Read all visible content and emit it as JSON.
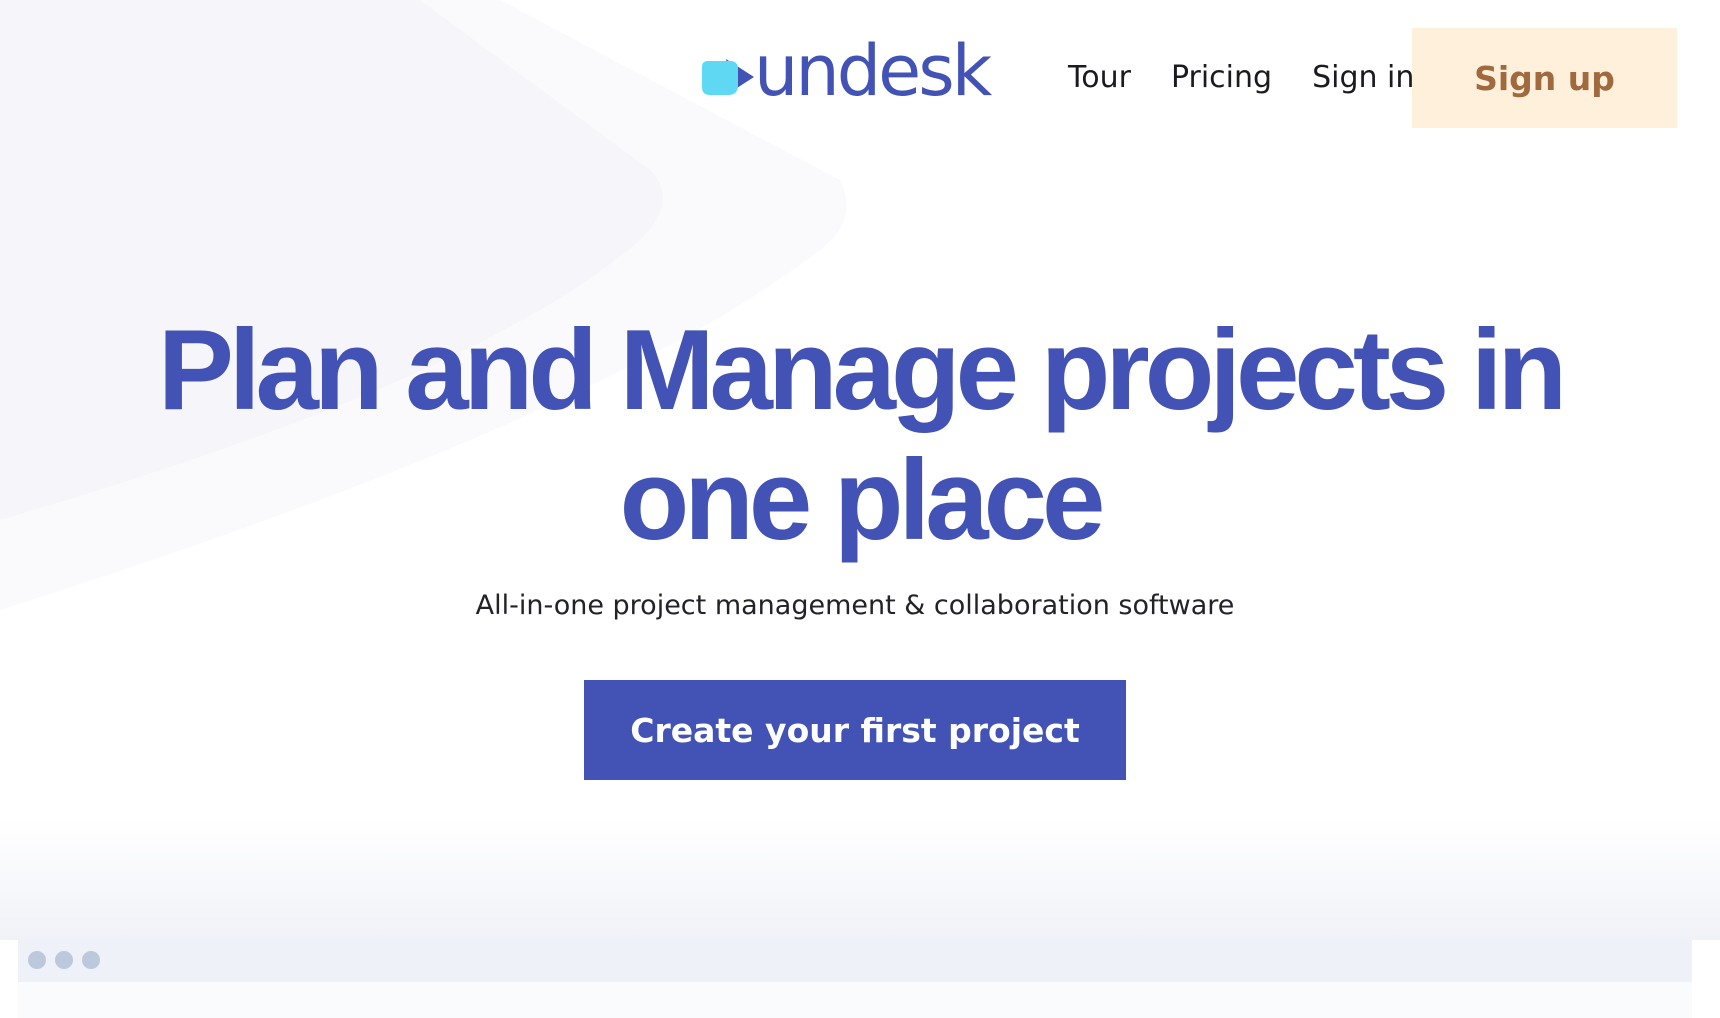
{
  "brand": {
    "name": "undesk",
    "color": "#4253b5",
    "accent": "#5fd8f4"
  },
  "nav": {
    "links": [
      "Tour",
      "Pricing",
      "Sign in"
    ],
    "signup_label": "Sign up",
    "signup_bg": "#fff0dc",
    "signup_fg": "#a06a3e"
  },
  "hero": {
    "title": "Plan and Manage projects in one place",
    "subtitle": "All-in-one project management & collaboration software",
    "cta_label": "Create your first project"
  },
  "preview": {
    "window_controls": [
      "dot",
      "dot",
      "dot"
    ]
  }
}
